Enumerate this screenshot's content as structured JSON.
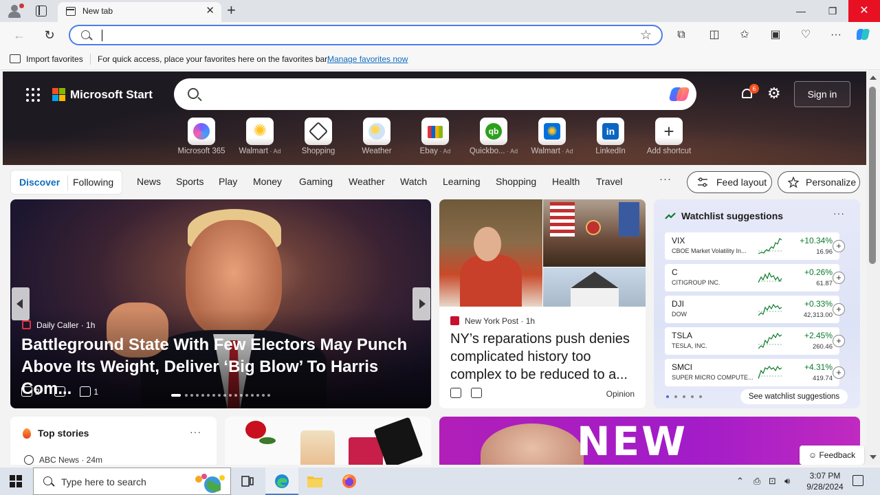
{
  "browser": {
    "tab_title": "New tab",
    "new_tab_symbol": "+",
    "url_value": "",
    "min_symbol": "—",
    "max_symbol": "❐",
    "close_symbol": "✕"
  },
  "favorites_bar": {
    "import_label": "Import favorites",
    "message": "For quick access, place your favorites here on the favorites bar.",
    "manage_link": "Manage favorites now"
  },
  "header": {
    "brand": "Microsoft Start",
    "search_placeholder": "",
    "notification_count": "6",
    "signin_label": "Sign in"
  },
  "shortcuts": [
    {
      "label": "Microsoft 365",
      "ad": "",
      "color": "#7b5cff"
    },
    {
      "label": "Walmart",
      "ad": " · Ad",
      "color": "#ffc220"
    },
    {
      "label": "Shopping",
      "ad": "",
      "color": "#ffffff"
    },
    {
      "label": "Weather",
      "ad": "",
      "color": "#9fc9ef"
    },
    {
      "label": "Ebay",
      "ad": " · Ad",
      "color": "#e53238"
    },
    {
      "label": "Quickbo...",
      "ad": " · Ad",
      "color": "#2ca01c"
    },
    {
      "label": "Walmart",
      "ad": " · Ad",
      "color": "#0071dc"
    },
    {
      "label": "LinkedIn",
      "ad": "",
      "color": "#0a66c2"
    },
    {
      "label": "Add shortcut",
      "ad": "",
      "color": "#ffffff"
    }
  ],
  "nav": {
    "discover": "Discover",
    "following": "Following",
    "items": [
      "News",
      "Sports",
      "Play",
      "Money",
      "Gaming",
      "Weather",
      "Watch",
      "Learning",
      "Shopping",
      "Health",
      "Travel"
    ],
    "more": "···",
    "feed_layout": "Feed layout",
    "personalize": "Personalize"
  },
  "hero_article": {
    "source": "Daily Caller",
    "age": "1h",
    "title": "Battleground State With Few Electors May Punch Above Its Weight, Deliver ‘Big Blow’ To Harris Com...",
    "likes": "2",
    "comments": "1"
  },
  "article2": {
    "source": "New York Post",
    "age": "1h",
    "title": "NY’s reparations push denies complicated history too complex to be reduced to a...",
    "tag": "Opinion"
  },
  "watchlist": {
    "title": "Watchlist suggestions",
    "more": "···",
    "see_all": "See watchlist suggestions",
    "stocks": [
      {
        "symbol": "VIX",
        "name": "CBOE Market Volatility In...",
        "change": "+10.34%",
        "price": "16.96"
      },
      {
        "symbol": "C",
        "name": "CITIGROUP INC.",
        "change": "+0.26%",
        "price": "61.87"
      },
      {
        "symbol": "DJI",
        "name": "DOW",
        "change": "+0.33%",
        "price": "42,313.00"
      },
      {
        "symbol": "TSLA",
        "name": "TESLA, INC.",
        "change": "+2.45%",
        "price": "260.46"
      },
      {
        "symbol": "SMCI",
        "name": "SUPER MICRO COMPUTE...",
        "change": "+4.31%",
        "price": "419.74"
      }
    ]
  },
  "top_stories": {
    "title": "Top stories",
    "more": "···",
    "source": "ABC News · 24m"
  },
  "ad_banner": {
    "text": "NEW TOOLS"
  },
  "feedback_label": "Feedback",
  "taskbar": {
    "search_placeholder": "Type here to search",
    "time": "3:07 PM",
    "date": "9/28/2024"
  },
  "colors": {
    "accent": "#0f6cbd",
    "positive": "#0c7a2c",
    "close_red": "#e81123"
  }
}
